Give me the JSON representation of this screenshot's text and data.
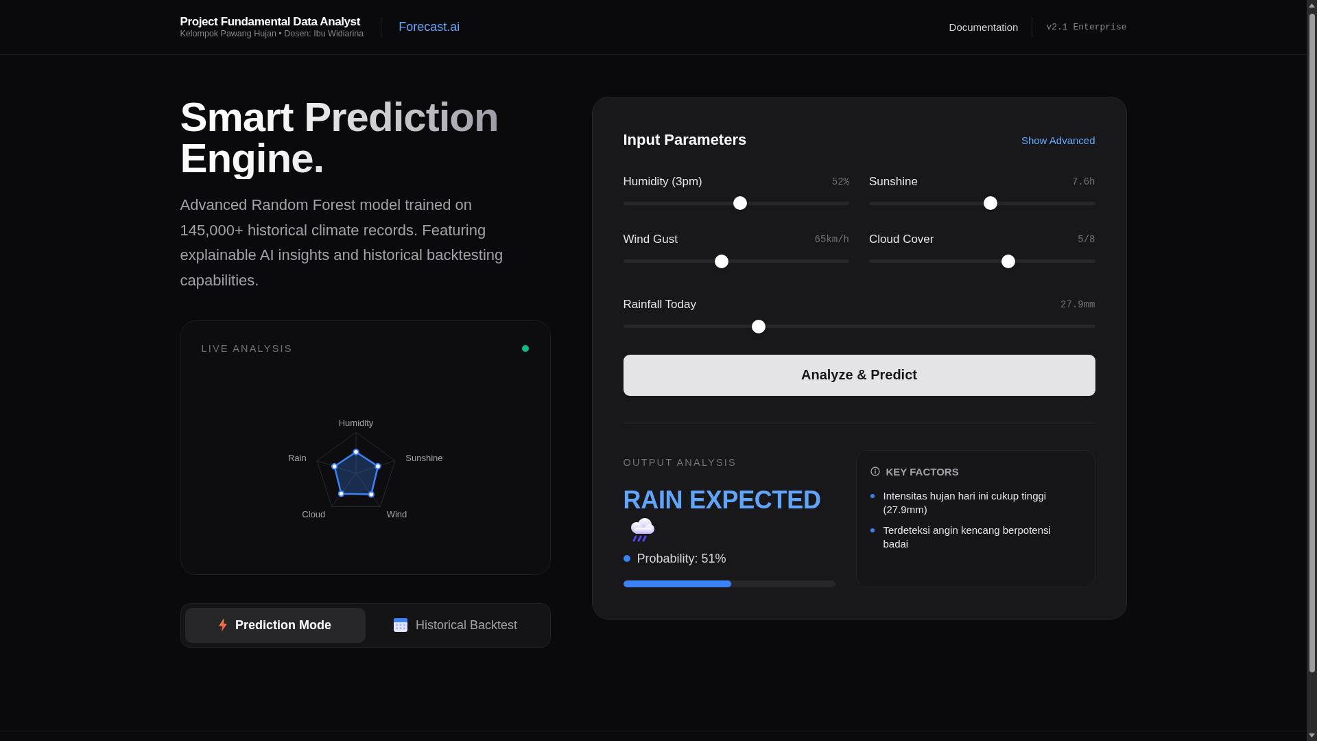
{
  "header": {
    "title": "Project Fundamental Data Analyst",
    "subtitle": "Kelompok Pawang Hujan • Dosen: Ibu Widiarina",
    "brand": "Forecast.ai",
    "links": [
      "Documentation"
    ],
    "version": "v2.1 Enterprise"
  },
  "hero": {
    "title": "Smart Prediction Engine.",
    "description": "Advanced Random Forest model trained on 145,000+ historical climate records. Featuring explainable AI insights and historical backtesting capabilities."
  },
  "live_analysis": {
    "title": "LIVE ANALYSIS",
    "active": true,
    "radar_labels": [
      "Humidity",
      "Sunshine",
      "Wind",
      "Cloud",
      "Rain"
    ]
  },
  "modes": [
    {
      "label": "Prediction Mode",
      "selected": true
    },
    {
      "label": "Historical Backtest",
      "selected": false
    }
  ],
  "input_panel": {
    "title": "Input Parameters",
    "action": "Show Advanced",
    "sliders": [
      {
        "label": "Humidity (3pm)",
        "reading": "52%",
        "level": 0.52
      },
      {
        "label": "Sunshine",
        "reading": "7.6h",
        "level": 0.54
      },
      {
        "label": "Wind Gust",
        "reading": "65km/h",
        "level": 0.43
      },
      {
        "label": "Cloud Cover",
        "reading": "5/8",
        "level": 0.625
      },
      {
        "label": "Rainfall Today",
        "reading": "27.9mm",
        "level": 0.28
      }
    ],
    "button": "Analyze & Predict"
  },
  "output": {
    "title": "OUTPUT ANALYSIS",
    "kind": "rain",
    "result": "RAIN EXPECTED",
    "probability": "Probability: 51%",
    "level": 0.51,
    "key_factors": {
      "title": "KEY FACTORS",
      "items": [
        "Intensitas hujan hari ini cukup tinggi (27.9mm)",
        "Terdeteksi angin kencang berpotensi badai"
      ]
    }
  }
}
